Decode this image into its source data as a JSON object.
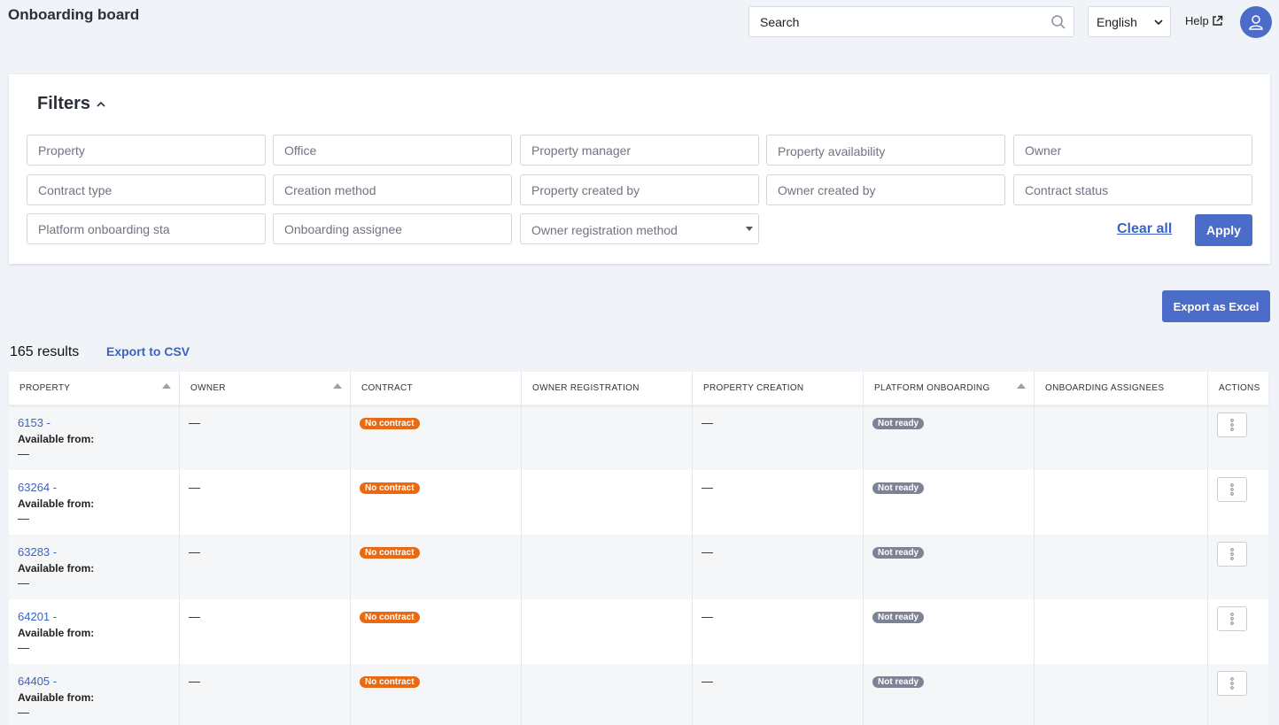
{
  "header": {
    "title": "Onboarding board",
    "search_placeholder": "Search",
    "language": "English",
    "help_label": "Help"
  },
  "filters": {
    "heading": "Filters",
    "fields": {
      "property": "Property",
      "office": "Office",
      "property_manager": "Property manager",
      "property_availability": "Property availability",
      "owner": "Owner",
      "contract_type": "Contract type",
      "creation_method": "Creation method",
      "property_created_by": "Property created by",
      "owner_created_by": "Owner created by",
      "contract_status": "Contract status",
      "platform_onboarding_status": "Platform onboarding stа",
      "onboarding_assignee": "Onboarding assignee",
      "owner_registration_method": "Owner registration method"
    },
    "clear_all": "Clear all",
    "apply": "Apply"
  },
  "export_excel": "Export as Excel",
  "results": {
    "count_text": "165 results",
    "export_csv": "Export to CSV"
  },
  "table": {
    "columns": [
      "PROPERTY",
      "OWNER",
      "CONTRACT",
      "OWNER REGISTRATION",
      "PROPERTY CREATION",
      "PLATFORM ONBOARDING",
      "ONBOARDING ASSIGNEES",
      "ACTIONS"
    ],
    "available_label": "Available from:",
    "rows": [
      {
        "property": "6153 -",
        "available": "—",
        "owner": "—",
        "contract": "No contract",
        "owner_registration": "",
        "property_creation": "—",
        "platform_onboarding": "Not ready",
        "assignees": ""
      },
      {
        "property": "63264 -",
        "available": "—",
        "owner": "—",
        "contract": "No contract",
        "owner_registration": "",
        "property_creation": "—",
        "platform_onboarding": "Not ready",
        "assignees": ""
      },
      {
        "property": "63283 -",
        "available": "—",
        "owner": "—",
        "contract": "No contract",
        "owner_registration": "",
        "property_creation": "—",
        "platform_onboarding": "Not ready",
        "assignees": ""
      },
      {
        "property": "64201 -",
        "available": "—",
        "owner": "—",
        "contract": "No contract",
        "owner_registration": "",
        "property_creation": "—",
        "platform_onboarding": "Not ready",
        "assignees": ""
      },
      {
        "property": "64405 -",
        "available": "—",
        "owner": "—",
        "contract": "No contract",
        "owner_registration": "",
        "property_creation": "—",
        "platform_onboarding": "Not ready",
        "assignees": ""
      }
    ]
  },
  "colors": {
    "accent": "#4c6cc9",
    "link": "#3b63c4",
    "badge_no_contract": "#e96a12",
    "badge_not_ready": "#7d8394"
  },
  "icons": [
    "search-icon",
    "chevron-down-icon",
    "external-link-icon",
    "user-icon",
    "chevron-up-icon",
    "sort-arrow-icon",
    "kebab-menu-icon"
  ]
}
